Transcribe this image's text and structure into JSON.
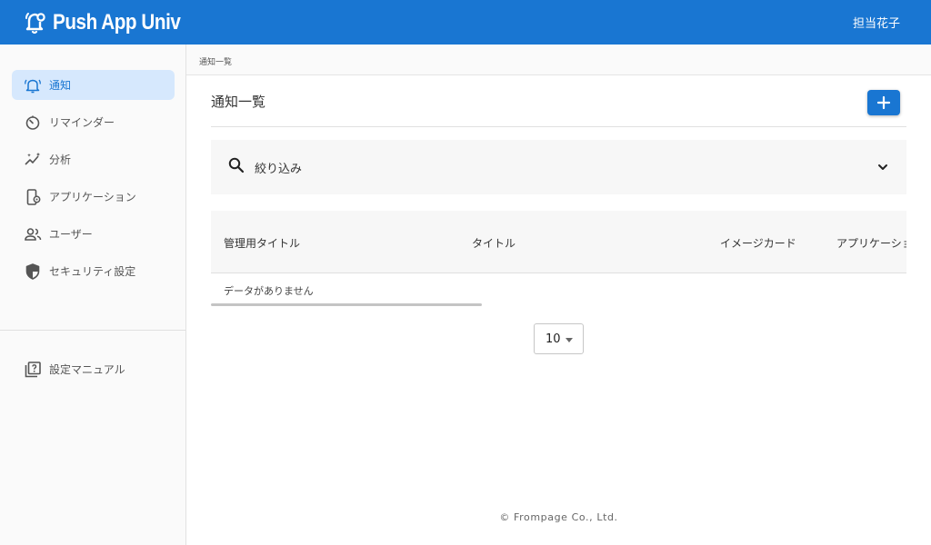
{
  "app": {
    "title": "Push App Univ",
    "user_name": "担当花子"
  },
  "sidebar": {
    "items": [
      {
        "label": "通知",
        "icon": "bell-icon",
        "active": true
      },
      {
        "label": "リマインダー",
        "icon": "timer-icon"
      },
      {
        "label": "分析",
        "icon": "analytics-icon"
      },
      {
        "label": "アプリケーション",
        "icon": "phone-settings-icon"
      },
      {
        "label": "ユーザー",
        "icon": "users-icon"
      },
      {
        "label": "セキュリティ設定",
        "icon": "shield-icon"
      }
    ],
    "manual": {
      "label": "設定マニュアル",
      "icon": "help-book-icon"
    }
  },
  "breadcrumb": "通知一覧",
  "page": {
    "title": "通知一覧",
    "add_button": "add-icon"
  },
  "filter": {
    "label": "絞り込み",
    "icon": "search-icon"
  },
  "table": {
    "columns": [
      "管理用タイトル",
      "タイトル",
      "イメージカード",
      "アプリケーション"
    ],
    "empty_text": "データがありません"
  },
  "pagination": {
    "rows_per_page": "10"
  },
  "footer": "© Frompage Co., Ltd.",
  "colors": {
    "primary": "#1976d2",
    "active_bg": "#d6e8fd"
  }
}
